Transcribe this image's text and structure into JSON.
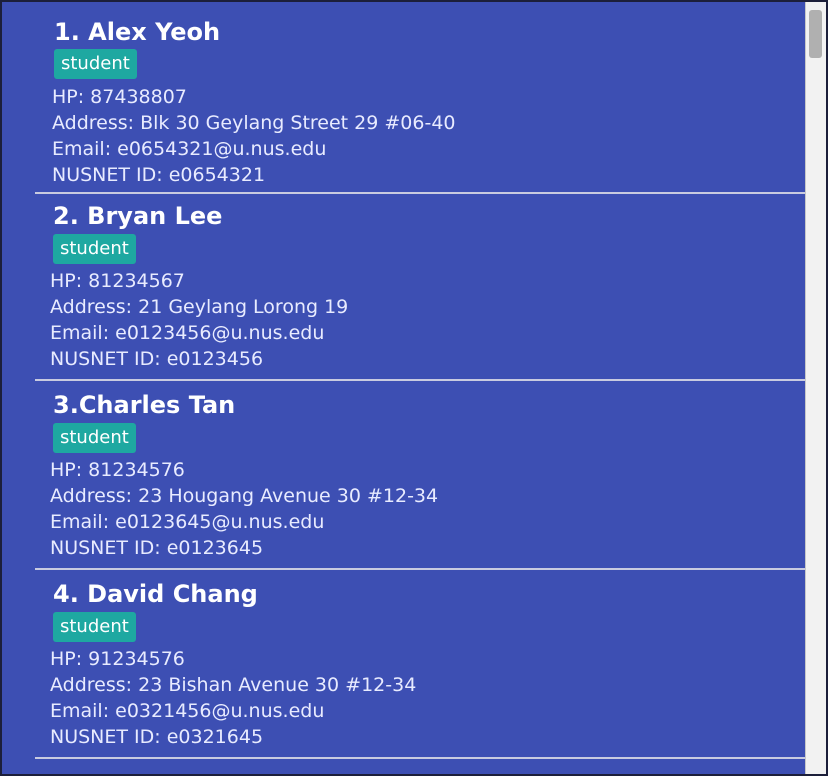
{
  "persons": [
    {
      "name": "1. Alex Yeoh",
      "tag": "student",
      "phone": "HP: 87438807",
      "address": "Address: Blk 30 Geylang Street 29 #06-40",
      "email": "Email: e0654321@u.nus.edu",
      "nusnet": "NUSNET ID: e0654321"
    },
    {
      "name": "2. Bryan Lee",
      "tag": "student",
      "phone": "HP: 81234567",
      "address": "Address: 21 Geylang Lorong 19",
      "email": "Email: e0123456@u.nus.edu",
      "nusnet": "NUSNET ID: e0123456"
    },
    {
      "name": "3.Charles Tan",
      "tag": "student",
      "phone": "HP: 81234576",
      "address": "Address: 23 Hougang Avenue 30 #12-34",
      "email": "Email: e0123645@u.nus.edu",
      "nusnet": "NUSNET ID: e0123645"
    },
    {
      "name": "4. David Chang",
      "tag": "student",
      "phone": "HP: 91234576",
      "address": "Address: 23 Bishan Avenue 30 #12-34",
      "email": "Email: e0321456@u.nus.edu",
      "nusnet": "NUSNET ID: e0321645"
    }
  ],
  "colors": {
    "panel_background": "#3d4fb3",
    "tag_background": "#1ea8a1",
    "divider": "#c9cbe0",
    "text": "#ffffff"
  }
}
